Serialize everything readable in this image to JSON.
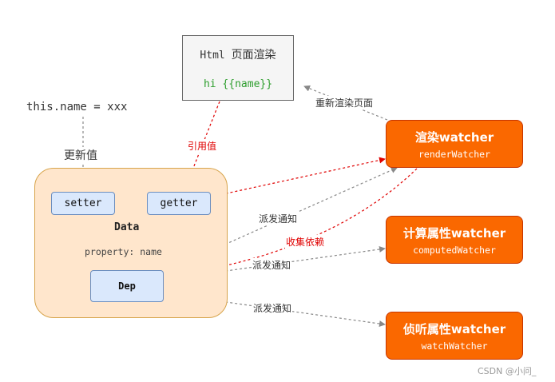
{
  "html_box": {
    "title_code": "Html",
    "title_cn": "页面渲染",
    "template": "hi {{name}}"
  },
  "assignment": "this.name = xxx",
  "update_label": "更新值",
  "data_box": {
    "title": "Data",
    "property": "property: name",
    "setter": "setter",
    "getter": "getter",
    "dep": "Dep"
  },
  "watchers": {
    "render": {
      "name": "渲染watcher",
      "sub": "renderWatcher"
    },
    "computed": {
      "name": "计算属性watcher",
      "sub": "computedWatcher"
    },
    "watch": {
      "name": "侦听属性watcher",
      "sub": "watchWatcher"
    }
  },
  "edge_labels": {
    "rerender": "重新渲染页面",
    "reference": "引用值",
    "notify_1": "派发通知",
    "collect": "收集依赖",
    "notify_2": "派发通知",
    "notify_3": "派发通知"
  },
  "watermark": "CSDN @小问_",
  "colors": {
    "watcher_fill": "#fa6800",
    "data_fill": "#ffe6cc",
    "node_fill": "#dae8fc",
    "red_arrow": "#e00000",
    "gray_arrow": "#888888"
  }
}
